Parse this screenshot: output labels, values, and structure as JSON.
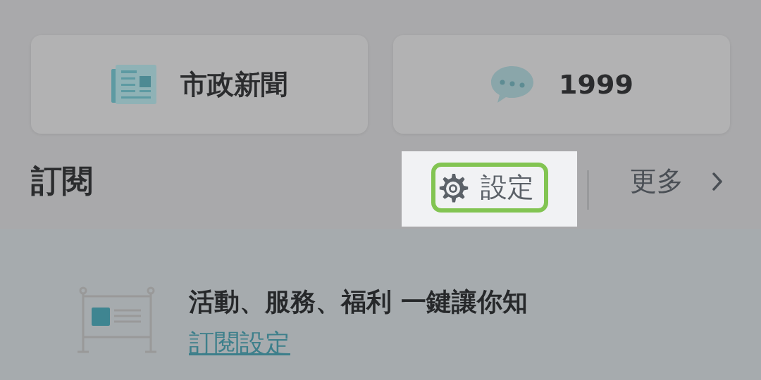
{
  "shortcuts": [
    {
      "kind": "news",
      "label": "市政新聞"
    },
    {
      "kind": "chat",
      "label": "1999"
    }
  ],
  "subscription": {
    "title": "訂閱",
    "settings_label": "設定",
    "settings_highlighted": true,
    "more_label": "更多"
  },
  "promo": {
    "text": "活動、服務、福利 一鍵讓你知",
    "link": "訂閱設定"
  }
}
